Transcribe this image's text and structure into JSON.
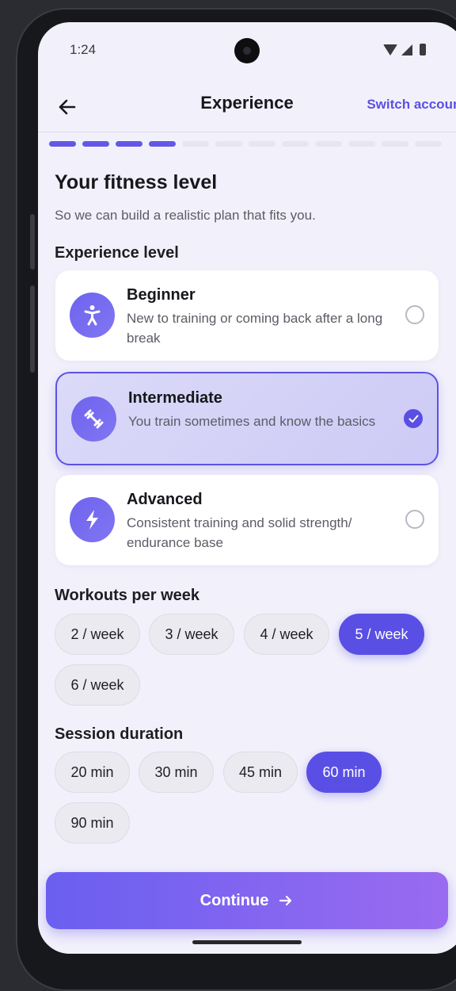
{
  "status_bar": {
    "time": "1:24"
  },
  "header": {
    "title": "Experience",
    "switch_account": "Switch account"
  },
  "progress": {
    "total_steps": 12,
    "completed_steps": 4
  },
  "page": {
    "heading": "Your fitness level",
    "subheading": "So we can build a realistic plan that fits you."
  },
  "experience": {
    "label": "Experience level",
    "options": [
      {
        "title": "Beginner",
        "description": "New to training or coming back after a long break",
        "icon": "person-icon",
        "selected": false
      },
      {
        "title": "Intermediate",
        "description": "You train sometimes and know the basics",
        "icon": "dumbbell-icon",
        "selected": true
      },
      {
        "title": "Advanced",
        "description": "Consistent training and solid strength/ endurance base",
        "icon": "lightning-icon",
        "selected": false
      }
    ]
  },
  "workouts": {
    "label": "Workouts per week",
    "options": [
      "2 / week",
      "3 / week",
      "4 / week",
      "5 / week",
      "6 / week"
    ],
    "selected": "5 / week"
  },
  "duration": {
    "label": "Session duration",
    "options": [
      "20 min",
      "30 min",
      "45 min",
      "60 min",
      "90 min"
    ],
    "selected": "60 min"
  },
  "cta": {
    "label": "Continue"
  },
  "colors": {
    "accent": "#5a4fe5",
    "background": "#f2f1fb"
  }
}
